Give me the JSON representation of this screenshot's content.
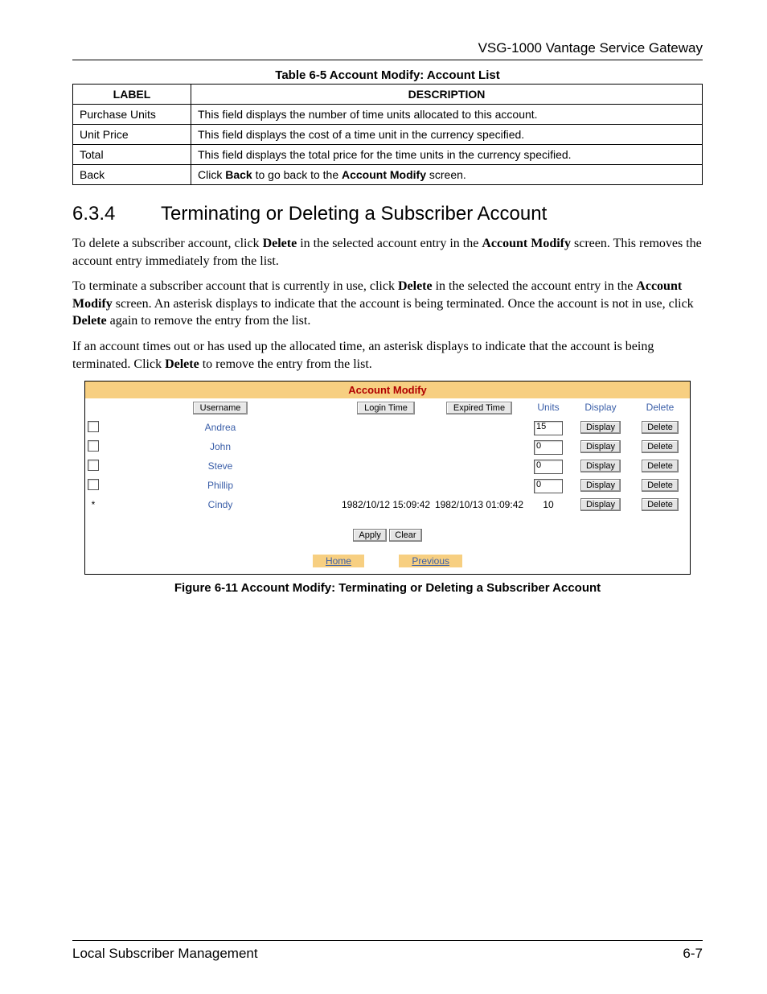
{
  "header": {
    "product_title": "VSG-1000 Vantage Service Gateway"
  },
  "def_table": {
    "caption": "Table 6-5 Account Modify: Account List",
    "columns": {
      "label": "LABEL",
      "description": "DESCRIPTION"
    },
    "rows": [
      {
        "label": "Purchase Units",
        "description": "This field displays the number of time units allocated to this account."
      },
      {
        "label": "Unit Price",
        "description": "This field displays the cost of a time unit in the currency specified."
      },
      {
        "label": "Total",
        "description": "This field displays the total price for the time units in the currency specified."
      },
      {
        "label": "Back",
        "description_pre": "Click ",
        "bold1": "Back",
        "mid": " to go back to the ",
        "bold2": "Account Modify",
        "post": " screen."
      }
    ]
  },
  "section": {
    "number": "6.3.4",
    "title": "Terminating or Deleting a Subscriber Account"
  },
  "paragraphs": {
    "p1_pre": "To delete a subscriber account, click ",
    "p1_b1": "Delete",
    "p1_mid": " in the selected account entry in the ",
    "p1_b2": "Account Modify",
    "p1_post": " screen. This removes the account entry immediately from the list.",
    "p2_pre": "To terminate a subscriber account that is currently in use, click ",
    "p2_b1": "Delete",
    "p2_mid1": " in the selected the account entry in the ",
    "p2_b2": "Account Modify",
    "p2_mid2": " screen. An asterisk displays to indicate that the account is being terminated. Once the account is not in use, click ",
    "p2_b3": "Delete",
    "p2_post": " again to remove the entry from the list.",
    "p3_pre": "If an account times out or has used up the allocated time, an asterisk displays to indicate that the account is being terminated. Click ",
    "p3_b1": "Delete",
    "p3_post": " to remove the entry from the list."
  },
  "screenshot": {
    "title": "Account Modify",
    "headers": {
      "username": "Username",
      "login_time": "Login Time",
      "expired_time": "Expired Time",
      "units": "Units",
      "display": "Display",
      "delete": "Delete"
    },
    "rows": [
      {
        "marker": "checkbox",
        "username": "Andrea",
        "login": "",
        "expired": "",
        "units": "15",
        "units_is_input": true,
        "display": "Display",
        "delete": "Delete"
      },
      {
        "marker": "checkbox",
        "username": "John",
        "login": "",
        "expired": "",
        "units": "0",
        "units_is_input": true,
        "display": "Display",
        "delete": "Delete"
      },
      {
        "marker": "checkbox",
        "username": "Steve",
        "login": "",
        "expired": "",
        "units": "0",
        "units_is_input": true,
        "display": "Display",
        "delete": "Delete"
      },
      {
        "marker": "checkbox",
        "username": "Phillip",
        "login": "",
        "expired": "",
        "units": "0",
        "units_is_input": true,
        "display": "Display",
        "delete": "Delete"
      },
      {
        "marker": "asterisk",
        "username": "Cindy",
        "login": "1982/10/12 15:09:42",
        "expired": "1982/10/13 01:09:42",
        "units": "10",
        "units_is_input": false,
        "display": "Display",
        "delete": "Delete"
      }
    ],
    "actions": {
      "apply": "Apply",
      "clear": "Clear"
    },
    "links": {
      "home": "Home",
      "previous": "Previous"
    }
  },
  "figure_caption": "Figure 6-11 Account Modify: Terminating or Deleting a Subscriber Account",
  "footer": {
    "left": "Local Subscriber Management",
    "right": "6-7"
  }
}
